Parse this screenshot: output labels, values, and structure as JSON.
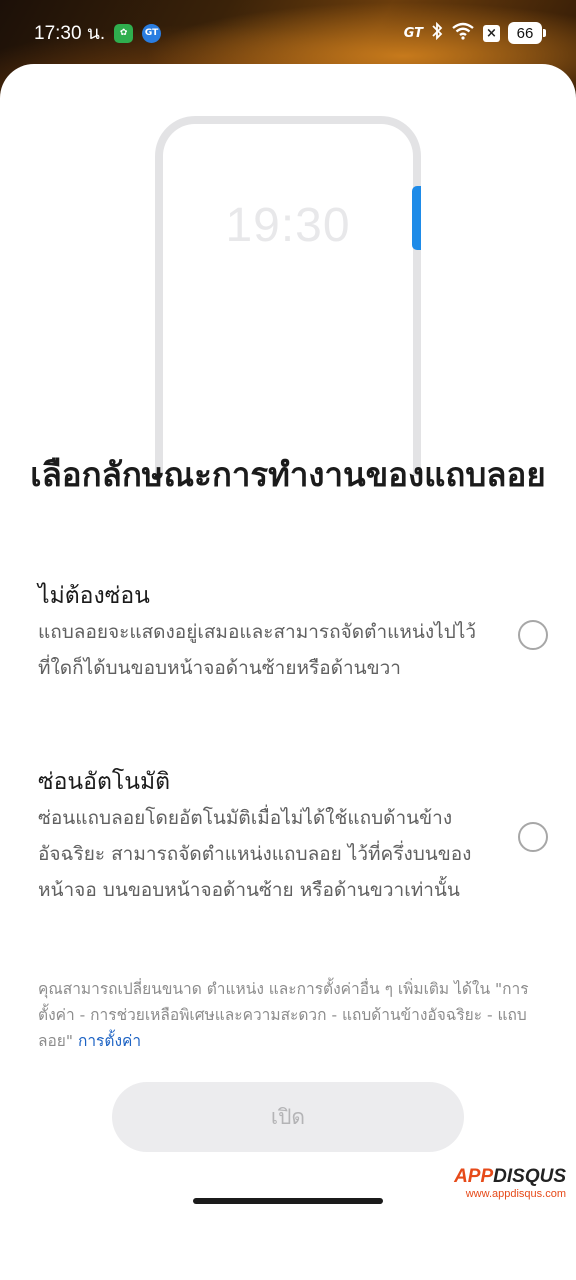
{
  "status_bar": {
    "time": "17:30 น.",
    "notif_icon_1_color": "#2fae4e",
    "notif_icon_2_label": "GT",
    "notif_icon_2_color": "#2a7de1",
    "gt_label": "GT",
    "battery": "66",
    "icons": [
      "bluetooth-icon",
      "wifi-icon",
      "close-box-icon",
      "battery-icon"
    ]
  },
  "illustration": {
    "phone_time": "19:30",
    "accent_color": "#1e8be8"
  },
  "dialog": {
    "title": "เลือกลักษณะการทำงานของแถบลอย",
    "options": [
      {
        "title": "ไม่ต้องซ่อน",
        "description": "แถบลอยจะแสดงอยู่เสมอและสามารถจัดตำแหน่งไปไว้ที่ใดก็ได้บนขอบหน้าจอด้านซ้ายหรือด้านขวา",
        "selected": false
      },
      {
        "title": "ซ่อนอัตโนมัติ",
        "description": "ซ่อนแถบลอยโดยอัตโนมัติเมื่อไม่ได้ใช้แถบด้านข้างอัจฉริยะ สามารถจัดตำแหน่งแถบลอย ไว้ที่ครึ่งบนของหน้าจอ บนขอบหน้าจอด้านซ้าย หรือด้านขวาเท่านั้น",
        "selected": false
      }
    ],
    "footnote_text": "คุณสามารถเปลี่ยนขนาด ตำแหน่ง และการตั้งค่าอื่น ๆ เพิ่มเติม ได้ใน \"การตั้งค่า - การช่วยเหลือพิเศษและความสะดวก - แถบด้านข้างอัจฉริยะ - แถบลอย\"",
    "footnote_link": "การตั้งค่า",
    "open_button": "เปิด"
  },
  "watermark": {
    "logo_part1": "APP",
    "logo_part2": "DISQUS",
    "url": "www.appdisqus.com"
  }
}
